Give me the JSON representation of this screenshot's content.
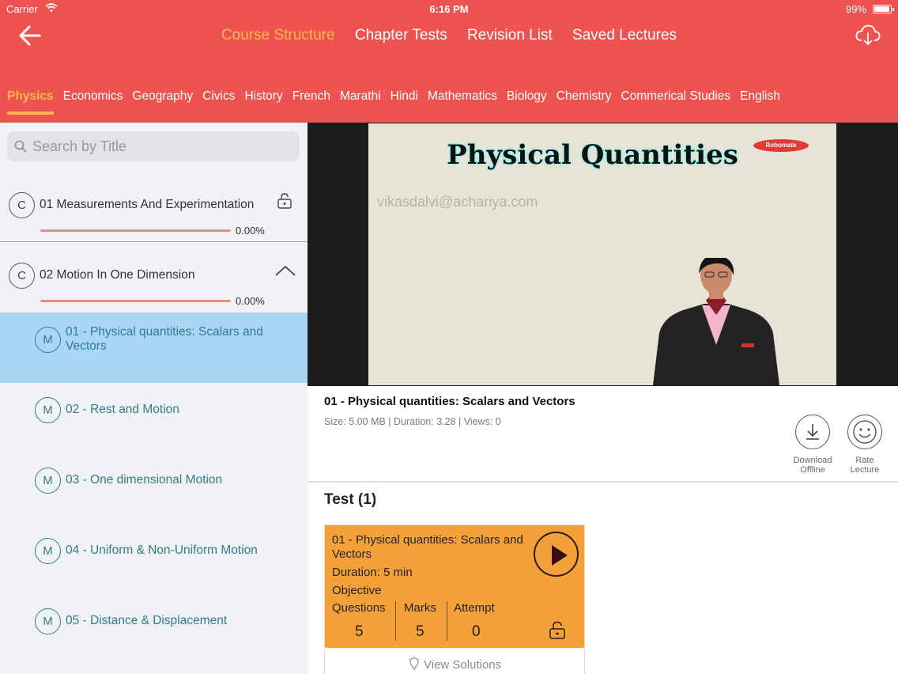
{
  "status": {
    "carrier": "Carrier",
    "time": "6:16 PM",
    "battery": "99%"
  },
  "topnav": [
    "Course Structure",
    "Chapter Tests",
    "Revision List",
    "Saved Lectures"
  ],
  "subjects": [
    "Physics",
    "Economics",
    "Geography",
    "Civics",
    "History",
    "French",
    "Marathi",
    "Hindi",
    "Mathematics",
    "Biology",
    "Chemistry",
    "Commerical Studies",
    "English"
  ],
  "search": {
    "placeholder": "Search by Title"
  },
  "chapters": [
    {
      "badge": "C",
      "title": "01 Measurements And Experimentation",
      "progress": "0.00%"
    },
    {
      "badge": "C",
      "title": "02 Motion In One Dimension",
      "progress": "0.00%"
    }
  ],
  "lectures": [
    {
      "badge": "M",
      "title": "01 - Physical quantities: Scalars and Vectors"
    },
    {
      "badge": "M",
      "title": "02 - Rest and Motion"
    },
    {
      "badge": "M",
      "title": "03 - One dimensional Motion"
    },
    {
      "badge": "M",
      "title": "04 - Uniform & Non-Uniform Motion"
    },
    {
      "badge": "M",
      "title": "05 - Distance & Displacement"
    }
  ],
  "video": {
    "slide_title": "Physical Quantities",
    "logo": "Robomate",
    "watermark": "vikasdalvi@achariya.com"
  },
  "lecture_info": {
    "title": "01 - Physical quantities: Scalars and Vectors",
    "meta": "Size: 5.00 MB | Duration: 3.28 | Views: 0",
    "download_label_1": "Download",
    "download_label_2": "Offline",
    "rate_label_1": "Rate",
    "rate_label_2": "Lecture"
  },
  "test": {
    "heading": "Test (1)",
    "title": "01 - Physical quantities: Scalars and Vectors",
    "duration": "Duration:  5 min",
    "type": "Objective",
    "questions_label": "Questions",
    "questions": "5",
    "marks_label": "Marks",
    "marks": "5",
    "attempt_label": "Attempt",
    "attempt": "0",
    "view_solutions": "View Solutions"
  },
  "colors": {
    "header": "#ef5350",
    "active": "#ffb74d",
    "selected_row": "#a9d6f2",
    "test_card": "#f5a13a",
    "lecture_text": "#2f7d8c"
  }
}
